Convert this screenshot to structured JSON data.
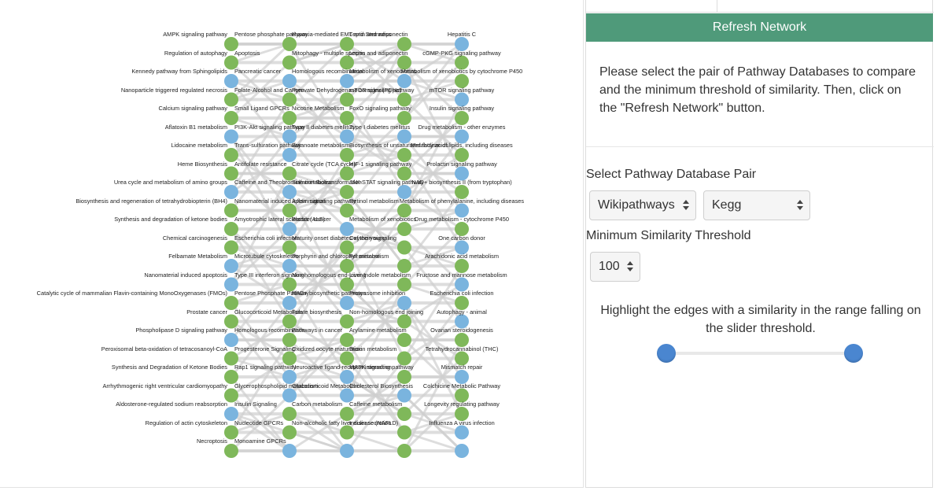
{
  "network": {
    "columns": [
      {
        "label_align": "left",
        "nodes": [
          {
            "label": "AMPK signaling pathway",
            "color": "green"
          },
          {
            "label": "Regulation of autophagy",
            "color": "green"
          },
          {
            "label": "Kennedy pathway from Sphingolipids",
            "color": "blue"
          },
          {
            "label": "Nanoparticle triggered regulated necrosis",
            "color": "green"
          },
          {
            "label": "Calcium signaling pathway",
            "color": "green"
          },
          {
            "label": "Aflatoxin B1 metabolism",
            "color": "blue"
          },
          {
            "label": "Lidocaine metabolism",
            "color": "green"
          },
          {
            "label": "Heme Biosynthesis",
            "color": "green"
          },
          {
            "label": "Urea cycle and metabolism of amino groups",
            "color": "blue"
          },
          {
            "label": "Biosynthesis and regeneration of tetrahydrobiopterin (BH4)",
            "color": "green"
          },
          {
            "label": "Synthesis and degradation of ketone bodies",
            "color": "green"
          },
          {
            "label": "Chemical carcinogenesis",
            "color": "green"
          },
          {
            "label": "Felbamate Metabolism",
            "color": "blue"
          },
          {
            "label": "Nanomaterial induced apoptosis",
            "color": "blue"
          },
          {
            "label": "Catalytic cycle of mammalian Flavin-containing MonoOxygenases (FMOs)",
            "color": "green"
          },
          {
            "label": "Prostate cancer",
            "color": "green"
          },
          {
            "label": "Phospholipase D signaling pathway",
            "color": "blue"
          },
          {
            "label": "Peroxisomal beta-oxidation of tetracosanoyl-CoA",
            "color": "green"
          },
          {
            "label": "Synthesis and Degradation of Ketone Bodies",
            "color": "green"
          },
          {
            "label": "Arrhythmogenic right ventricular cardiomyopathy",
            "color": "green"
          },
          {
            "label": "Aldosterone-regulated sodium reabsorption",
            "color": "blue"
          },
          {
            "label": "Regulation of actin cytoskeleton",
            "color": "green"
          },
          {
            "label": "Necroptosis",
            "color": "green"
          }
        ]
      },
      {
        "label_align": "left",
        "nodes": [
          {
            "label": "Pentose phosphate pathway",
            "color": "green"
          },
          {
            "label": "Apoptosis",
            "color": "green"
          },
          {
            "label": "Pancreatic cancer",
            "color": "blue"
          },
          {
            "label": "Folate-Alcohol and Cancer",
            "color": "green"
          },
          {
            "label": "Small Ligand GPCRs",
            "color": "green"
          },
          {
            "label": "PI3K-Akt signaling pathway",
            "color": "blue"
          },
          {
            "label": "Trans-sulfuration pathway",
            "color": "blue"
          },
          {
            "label": "Antifolate resistance",
            "color": "green"
          },
          {
            "label": "Caffeine and Theobromine metabolism",
            "color": "blue"
          },
          {
            "label": "Nanomaterial induced inflammation",
            "color": "green"
          },
          {
            "label": "Amyotrophic lateral sclerosis (ALS)",
            "color": "blue"
          },
          {
            "label": "Escherichia coli infection",
            "color": "green"
          },
          {
            "label": "Microtubule cytoskeleton",
            "color": "blue"
          },
          {
            "label": "Type III interferon signaling",
            "color": "green"
          },
          {
            "label": "Pentose Phosphate Pathway",
            "color": "blue"
          },
          {
            "label": "Glucocorticoid Metabolism",
            "color": "green"
          },
          {
            "label": "Homologous recombination",
            "color": "green"
          },
          {
            "label": "Progesterone Signaling",
            "color": "green"
          },
          {
            "label": "Rap1 signaling pathway",
            "color": "blue"
          },
          {
            "label": "Glycerophospholipid metabolism",
            "color": "blue"
          },
          {
            "label": "Insulin Signaling",
            "color": "green"
          },
          {
            "label": "Nucleotide GPCRs",
            "color": "green"
          },
          {
            "label": "Monoamine GPCRs",
            "color": "blue"
          }
        ]
      },
      {
        "label_align": "left",
        "nodes": [
          {
            "label": "Hypoxia-mediated EMT and Stemness",
            "color": "green"
          },
          {
            "label": "Mitophagy - multiple species",
            "color": "green"
          },
          {
            "label": "Homologous recombination",
            "color": "blue"
          },
          {
            "label": "Pyruvate Dehydrogenase complex (PDHc)",
            "color": "green"
          },
          {
            "label": "Nicotine Metabolism",
            "color": "green"
          },
          {
            "label": "Type II diabetes mellitus",
            "color": "blue"
          },
          {
            "label": "Butanoate metabolism",
            "color": "green"
          },
          {
            "label": "Citrate cycle (TCA cycle)",
            "color": "green"
          },
          {
            "label": "Sulfation Biotransformation",
            "color": "green"
          },
          {
            "label": "Apelin signaling pathway",
            "color": "green"
          },
          {
            "label": "Bladder cancer",
            "color": "blue"
          },
          {
            "label": "Maturity onset diabetes of the young",
            "color": "green"
          },
          {
            "label": "Porphyrin and chlorophyll metabolism",
            "color": "green"
          },
          {
            "label": "Non-homologous end-joining",
            "color": "green"
          },
          {
            "label": "NAD+ biosynthetic pathways",
            "color": "blue"
          },
          {
            "label": "Folate biosynthesis",
            "color": "green"
          },
          {
            "label": "Pathways in cancer",
            "color": "green"
          },
          {
            "label": "Oxidized oocyte maturation",
            "color": "green"
          },
          {
            "label": "Neuroactive ligand-receptor interaction",
            "color": "blue"
          },
          {
            "label": "Glucocorticoid Metabolism",
            "color": "blue"
          },
          {
            "label": "Carbon metabolism",
            "color": "green"
          },
          {
            "label": "Non-alcoholic fatty liver disease (NAFLD)",
            "color": "green"
          },
          {
            "label": "",
            "color": "blue"
          }
        ]
      },
      {
        "label_align": "left",
        "nodes": [
          {
            "label": "Leptin and adiponectin",
            "color": "green"
          },
          {
            "label": "Leptin and adiponectin",
            "color": "green"
          },
          {
            "label": "Metabolism of xenobiotics",
            "color": "blue"
          },
          {
            "label": "mTOR signaling pathway",
            "color": "green"
          },
          {
            "label": "FoxO signaling pathway",
            "color": "green"
          },
          {
            "label": "Type I diabetes mellitus",
            "color": "blue"
          },
          {
            "label": "Biosynthesis of unsaturated fatty acids",
            "color": "green"
          },
          {
            "label": "HIF-1 signaling pathway",
            "color": "green"
          },
          {
            "label": "JAK-STAT signaling pathway",
            "color": "blue"
          },
          {
            "label": "Retinol metabolism",
            "color": "green"
          },
          {
            "label": "Metabolism of xenobiotics",
            "color": "green"
          },
          {
            "label": "Oxytocin signaling",
            "color": "green"
          },
          {
            "label": "Peroxisome",
            "color": "green"
          },
          {
            "label": "Liver Indole metabolism",
            "color": "green"
          },
          {
            "label": "Proteasome inhibition",
            "color": "blue"
          },
          {
            "label": "Non-homologous end joining",
            "color": "green"
          },
          {
            "label": "Arylamine metabolism",
            "color": "green"
          },
          {
            "label": "Dioxin metabolism",
            "color": "green"
          },
          {
            "label": "MAPK signaling pathway",
            "color": "green"
          },
          {
            "label": "Cholesterol Biosynthesis",
            "color": "blue"
          },
          {
            "label": "Caffeine metabolism",
            "color": "green"
          },
          {
            "label": "Insulin secretion",
            "color": "green"
          },
          {
            "label": "",
            "color": "green"
          }
        ]
      },
      {
        "label_align": "center",
        "nodes": [
          {
            "label": "Hepatitis C",
            "color": "blue"
          },
          {
            "label": "cGMP-PKG signaling pathway",
            "color": "green"
          },
          {
            "label": "Metabolism of xenobiotics by cytochrome P450",
            "color": "green"
          },
          {
            "label": "mTOR signaling pathway",
            "color": "blue"
          },
          {
            "label": "Insulin signaling pathway",
            "color": "green"
          },
          {
            "label": "Drug metabolism - other enzymes",
            "color": "blue"
          },
          {
            "label": "Metabolism of lipids, including diseases",
            "color": "green"
          },
          {
            "label": "Prolactin signaling pathway",
            "color": "blue"
          },
          {
            "label": "NAD+ biosynthesis II (from tryptophan)",
            "color": "green"
          },
          {
            "label": "Metabolism of phenylalanine, including diseases",
            "color": "blue"
          },
          {
            "label": "Drug metabolism - cytochrome P450",
            "color": "green"
          },
          {
            "label": "One carbon donor",
            "color": "blue"
          },
          {
            "label": "Arachidonic acid metabolism",
            "color": "green"
          },
          {
            "label": "Fructose and mannose metabolism",
            "color": "blue"
          },
          {
            "label": "Escherichia coli infection",
            "color": "green"
          },
          {
            "label": "Autophagy - animal",
            "color": "blue"
          },
          {
            "label": "Ovarian steroidogenesis",
            "color": "green"
          },
          {
            "label": "Tetrahydrocannabinol (THC)",
            "color": "green"
          },
          {
            "label": "Mismatch repair",
            "color": "blue"
          },
          {
            "label": "Colchicine Metabolic Pathway",
            "color": "green"
          },
          {
            "label": "Longevity regulating pathway",
            "color": "green"
          },
          {
            "label": "Influenza A virus infection",
            "color": "blue"
          },
          {
            "label": "",
            "color": "blue"
          }
        ]
      }
    ],
    "colors": {
      "green": "#7fb85a",
      "blue": "#7ab4de",
      "edge": "#cfcfcf"
    }
  },
  "controls": {
    "refresh_label": "Refresh Network",
    "instructions": "Please select the pair of Pathway Databases to compare and the minimum threshold of similarity. Then, click on the \"Refresh Network\" button.",
    "db_pair_label": "Select Pathway Database Pair",
    "db_first": "Wikipathways",
    "db_second": "Kegg",
    "threshold_label": "Minimum Similarity Threshold",
    "threshold_value": "100",
    "highlight_text": "Highlight the edges with a similarity in the range falling on the slider threshold.",
    "slider": {
      "low": 0,
      "high": 1
    },
    "accent": "#4f9a7a",
    "handle_color": "#4a86d0"
  }
}
